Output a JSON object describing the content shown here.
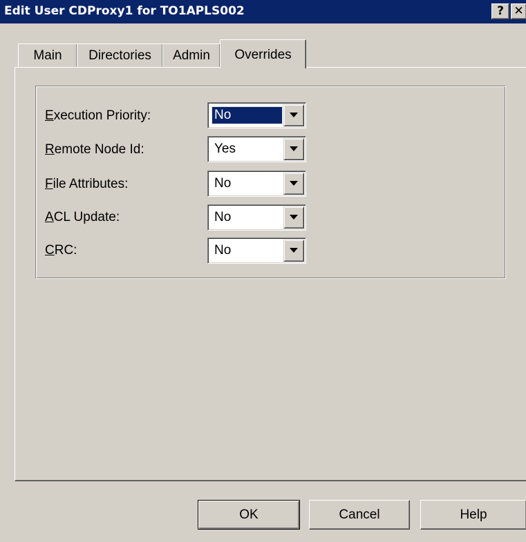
{
  "window": {
    "title": "Edit User CDProxy1 for TO1APLS002",
    "help_glyph": "?",
    "close_glyph": "✕"
  },
  "tabs": [
    {
      "label": "Main",
      "active": false
    },
    {
      "label": "Directories",
      "active": false
    },
    {
      "label": "Admin",
      "active": false
    },
    {
      "label": "Overrides",
      "active": true
    }
  ],
  "overrides": {
    "fields": [
      {
        "mnemonic": "E",
        "rest": "xecution Priority:",
        "value": "No",
        "selected": true
      },
      {
        "mnemonic": "R",
        "rest": "emote Node Id:",
        "value": "Yes",
        "selected": false
      },
      {
        "mnemonic": "F",
        "rest": "ile Attributes:",
        "value": "No",
        "selected": false
      },
      {
        "mnemonic": "A",
        "rest": "CL Update:",
        "value": "No",
        "selected": false
      },
      {
        "mnemonic": "C",
        "rest": "RC:",
        "value": "No",
        "selected": false
      }
    ]
  },
  "buttons": {
    "ok": "OK",
    "cancel": "Cancel",
    "help": "Help"
  },
  "colors": {
    "titlebar": "#0a246a",
    "face": "#d4d0c8",
    "selection": "#0a246a"
  }
}
